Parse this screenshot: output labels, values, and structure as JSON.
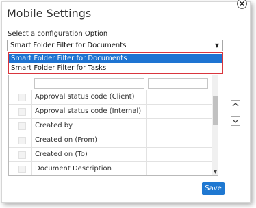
{
  "dialog": {
    "title": "Mobile Settings",
    "config_label": "Select a configuration Option",
    "selected_option": "Smart Folder Filter for Documents",
    "options": [
      "Smart Folder Filter for Documents",
      "Smart Folder Filter for Tasks"
    ],
    "fields": [
      "Approval status code (Client)",
      "Approval status code (Internal)",
      "Created by",
      "Created on (From)",
      "Created on (To)",
      "Document Description"
    ],
    "save_label": "Save",
    "icons": {
      "close": "close-icon",
      "dropdown": "chevron-down-icon",
      "move_up": "chevron-up-icon",
      "move_down": "chevron-down-icon"
    },
    "colors": {
      "accent": "#1f78d1",
      "highlight_border": "#d9363e",
      "selected_item": "#1e74d2"
    }
  }
}
